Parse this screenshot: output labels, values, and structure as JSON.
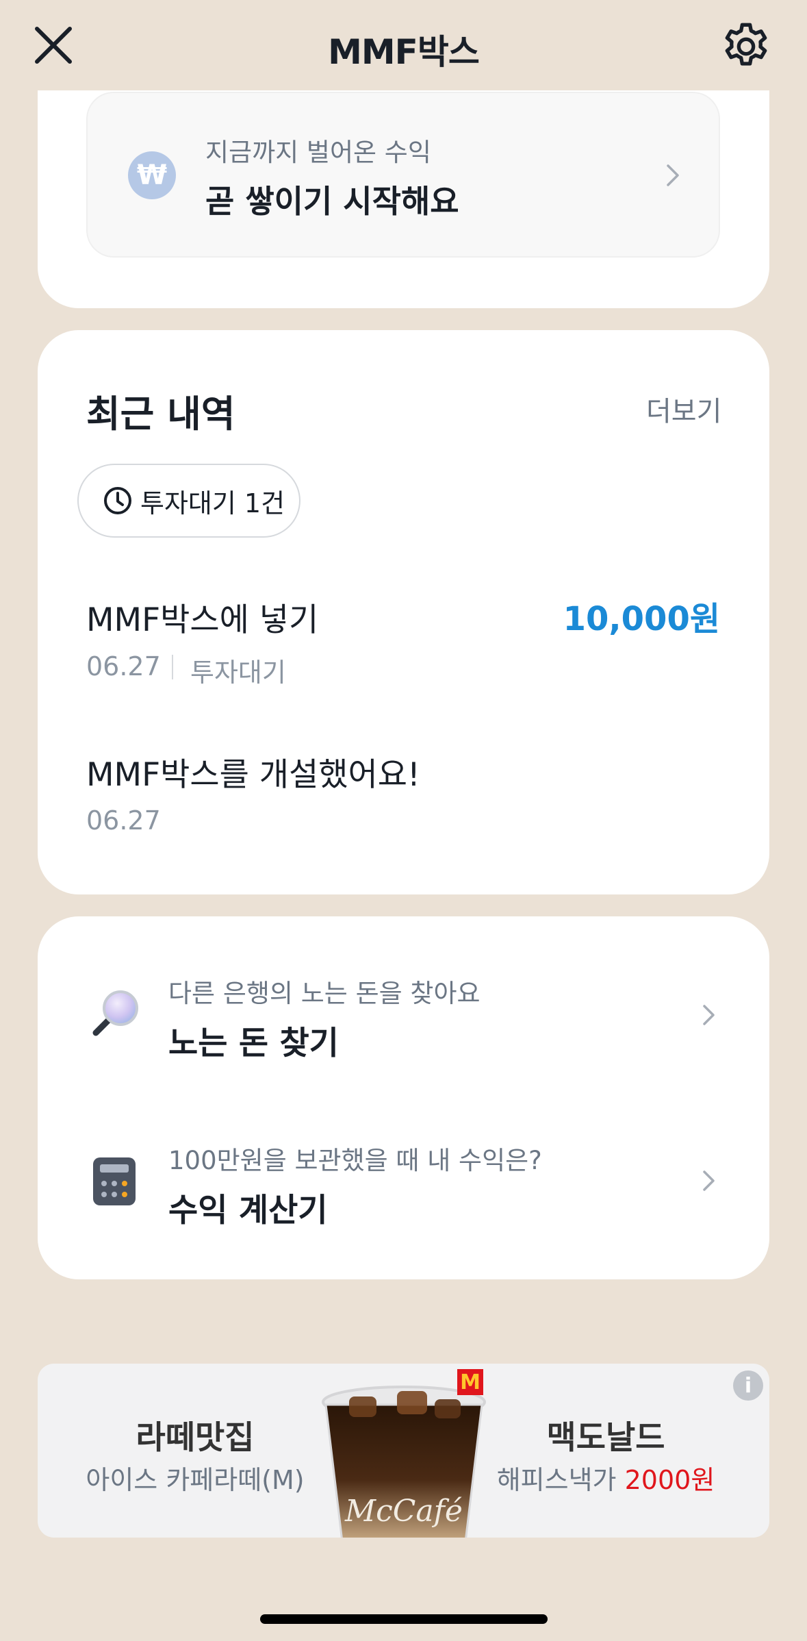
{
  "header": {
    "title": "MMF박스",
    "close_icon": "close-icon",
    "settings_icon": "gear-icon"
  },
  "earnings": {
    "currency_icon": "won-icon",
    "currency_symbol": "₩",
    "subtitle": "지금까지 벌어온 수익",
    "title": "곧 쌓이기 시작해요"
  },
  "recent": {
    "title": "최근 내역",
    "more_label": "더보기",
    "pending_chip": {
      "icon": "clock-icon",
      "label": "투자대기 1건"
    },
    "transactions": [
      {
        "title": "MMF박스에 넣기",
        "amount": "10,000원",
        "date": "06.27",
        "status": "투자대기"
      },
      {
        "title": "MMF박스를 개설했어요!",
        "date": "06.27"
      }
    ]
  },
  "menu": {
    "items": [
      {
        "icon": "magnifier-icon",
        "subtitle": "다른 은행의 노는 돈을 찾아요",
        "title": "노는 돈 찾기"
      },
      {
        "icon": "calculator-icon",
        "subtitle": "100만원을 보관했을 때 내 수익은?",
        "title": "수익 계산기"
      }
    ]
  },
  "ad": {
    "left_title": "라떼맛집",
    "left_sub": "아이스 카페라떼(M)",
    "right_title": "맥도날드",
    "right_sub_prefix": "해피스낵가 ",
    "right_sub_price": "2000원",
    "info_icon": "info-icon",
    "info_symbol": "i",
    "brand_logo_letter": "M",
    "cup_text": "McCafé",
    "price_color": "#e0161c"
  },
  "colors": {
    "background": "#ebe1d5",
    "amount": "#1b8ad6"
  }
}
